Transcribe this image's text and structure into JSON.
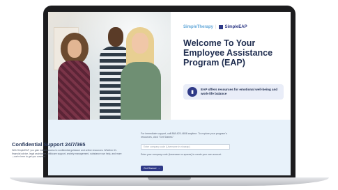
{
  "brand": {
    "logo_primary": "SimpleTherapy",
    "logo_separator": "|",
    "logo_secondary": "SimpleEAP"
  },
  "hero": {
    "title": "Welcome To Your Employee Assistance Program (EAP)",
    "info_text": "EAP offers resources for emotional well-being and work-life balance"
  },
  "support": {
    "title": "Confidential Support 24/7/365",
    "body": "With SimpleEAP, you gain instant access to confidential guidance and online resources. Whether it's financial advice, legal assistance, childcare support, anxiety management, substance use help, and more—we're here to get you covered."
  },
  "form": {
    "intro": "For immediate support, call 888-425-4808 anytime. To explore your program's resources, click \"Get Started.\"",
    "company_placeholder": "Enter company code (Username in ninaeap)",
    "note": "Enter your company code (lowercase no spaces) to create your own account.",
    "button_label": "Get Started",
    "button_arrow": "→"
  },
  "colors": {
    "navy": "#2f3a87",
    "light_blue_bg": "#e8f2fa",
    "title_text": "#1f2d4f"
  }
}
